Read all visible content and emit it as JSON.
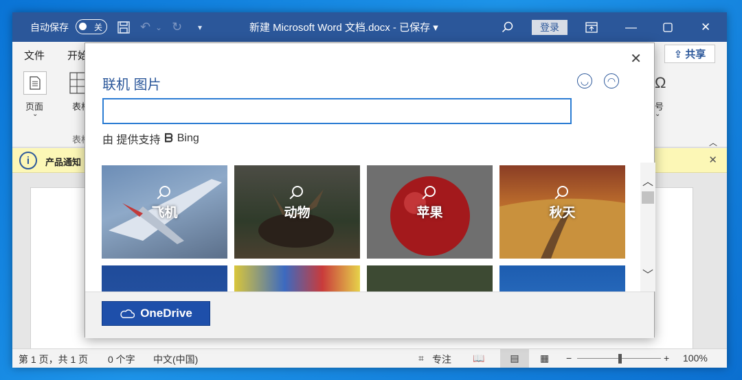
{
  "titlebar": {
    "autosave_label": "自动保存",
    "autosave_toggle": "关",
    "doc_title": "新建 Microsoft Word 文档.docx - 已保存 ▾",
    "login": "登录"
  },
  "menubar": {
    "items": [
      "文件",
      "开始"
    ],
    "share": "共享"
  },
  "ribbon": {
    "page_label": "页面",
    "table_label": "表格",
    "table_group": "表格",
    "symbol_label": "号"
  },
  "notice": {
    "info_glyph": "i",
    "text": "产品通知"
  },
  "statusbar": {
    "page_info": "第 1 页，共 1 页",
    "word_count": "0 个字",
    "language": "中文(中国)",
    "focus": "专注",
    "zoom": "100%"
  },
  "dialog": {
    "title": "联机 图片",
    "search_value": "",
    "powered_by": "由 提供支持",
    "bing": "Bing",
    "onedrive": "OneDrive",
    "tiles": [
      {
        "label": "飞机"
      },
      {
        "label": "动物"
      },
      {
        "label": "苹果"
      },
      {
        "label": "秋天"
      }
    ]
  }
}
